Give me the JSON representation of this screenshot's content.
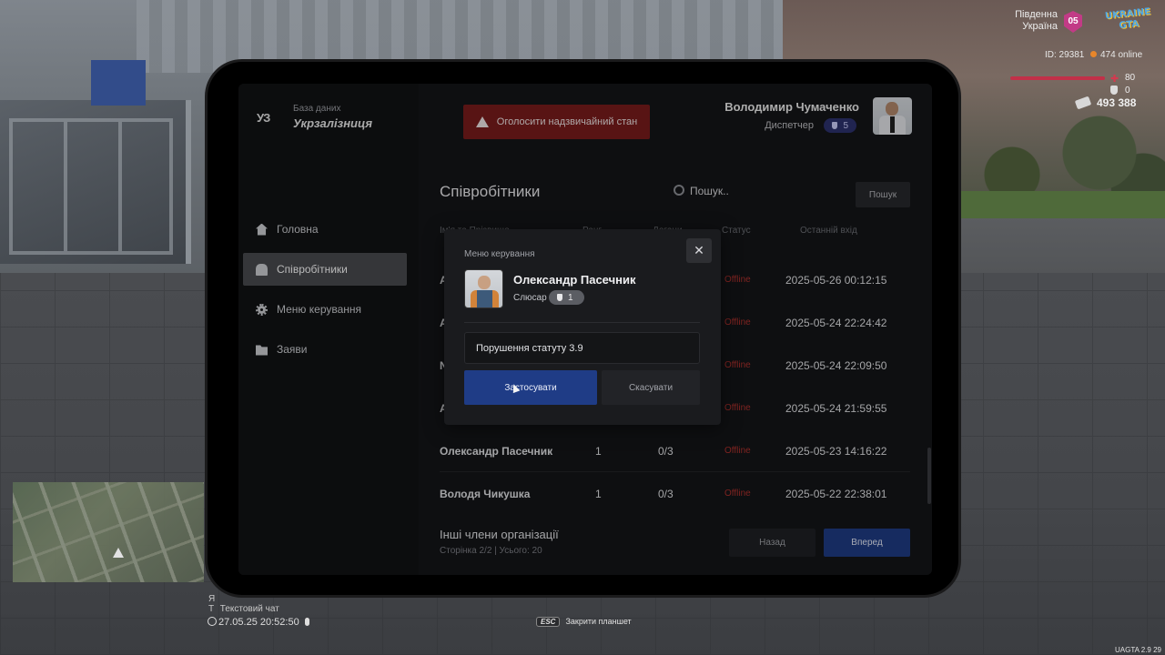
{
  "hud": {
    "region": "Південна Україна",
    "region_line1": "Південна",
    "region_line2": "Україна",
    "region_badge": "05",
    "logo_line1": "UKRAINE",
    "logo_line2": "GTA",
    "player_id": "ID: 29381",
    "online": "474 online",
    "health": "80",
    "armor": "0",
    "money": "493 388",
    "chat_key": "Я",
    "chat_text_key": "T",
    "chat_label": "Текстовий чат",
    "datetime": "27.05.25 20:52:50",
    "esc_key": "ESC",
    "esc_label": "Закрити планшет",
    "version": "UAGTA 2.9   29"
  },
  "app": {
    "logo": "УЗ",
    "subtitle": "База даних",
    "name": "Укрзалізниця",
    "emergency_button": "Оголосити надзвичайний стан",
    "user": {
      "name": "Володимир Чумаченко",
      "role": "Диспетчер",
      "level": "5"
    }
  },
  "sidebar": {
    "items": [
      {
        "label": "Головна",
        "icon": "home-icon"
      },
      {
        "label": "Співробітники",
        "icon": "people-icon"
      },
      {
        "label": "Меню керування",
        "icon": "gear-icon"
      },
      {
        "label": "Заяви",
        "icon": "folder-icon"
      }
    ],
    "active_index": 1
  },
  "main": {
    "title": "Співробітники",
    "search_placeholder": "Пошук..",
    "search_button": "Пошук",
    "columns": [
      "Ім'я та Прізвище",
      "Ранг",
      "Догани",
      "Статус",
      "Останній вхід"
    ],
    "rows": [
      {
        "name": "А",
        "rank": "",
        "warns": "",
        "status": "Offline",
        "last_login": "2025-05-26 00:12:15"
      },
      {
        "name": "А",
        "rank": "",
        "warns": "",
        "status": "Offline",
        "last_login": "2025-05-24 22:24:42"
      },
      {
        "name": "N",
        "rank": "",
        "warns": "",
        "status": "Offline",
        "last_login": "2025-05-24 22:09:50"
      },
      {
        "name": "А",
        "rank": "",
        "warns": "",
        "status": "Offline",
        "last_login": "2025-05-24 21:59:55"
      },
      {
        "name": "Олександр Пасечник",
        "rank": "1",
        "warns": "0/3",
        "status": "Offline",
        "last_login": "2025-05-23 14:16:22"
      },
      {
        "name": "Володя Чикушка",
        "rank": "1",
        "warns": "0/3",
        "status": "Offline",
        "last_login": "2025-05-22 22:38:01"
      }
    ],
    "footer_title": "Інші члени організації",
    "pagination": "Сторінка 2/2 | Усього: 20",
    "back_button": "Назад",
    "next_button": "Вперед"
  },
  "modal": {
    "title": "Меню керування",
    "close": "✕",
    "employee_name": "Олександр Пасечник",
    "employee_role": "Слюсар",
    "employee_level": "1",
    "reason_value": "Порушення статуту 3.9",
    "apply_button": "Застосувати",
    "cancel_button": "Скасувати"
  }
}
